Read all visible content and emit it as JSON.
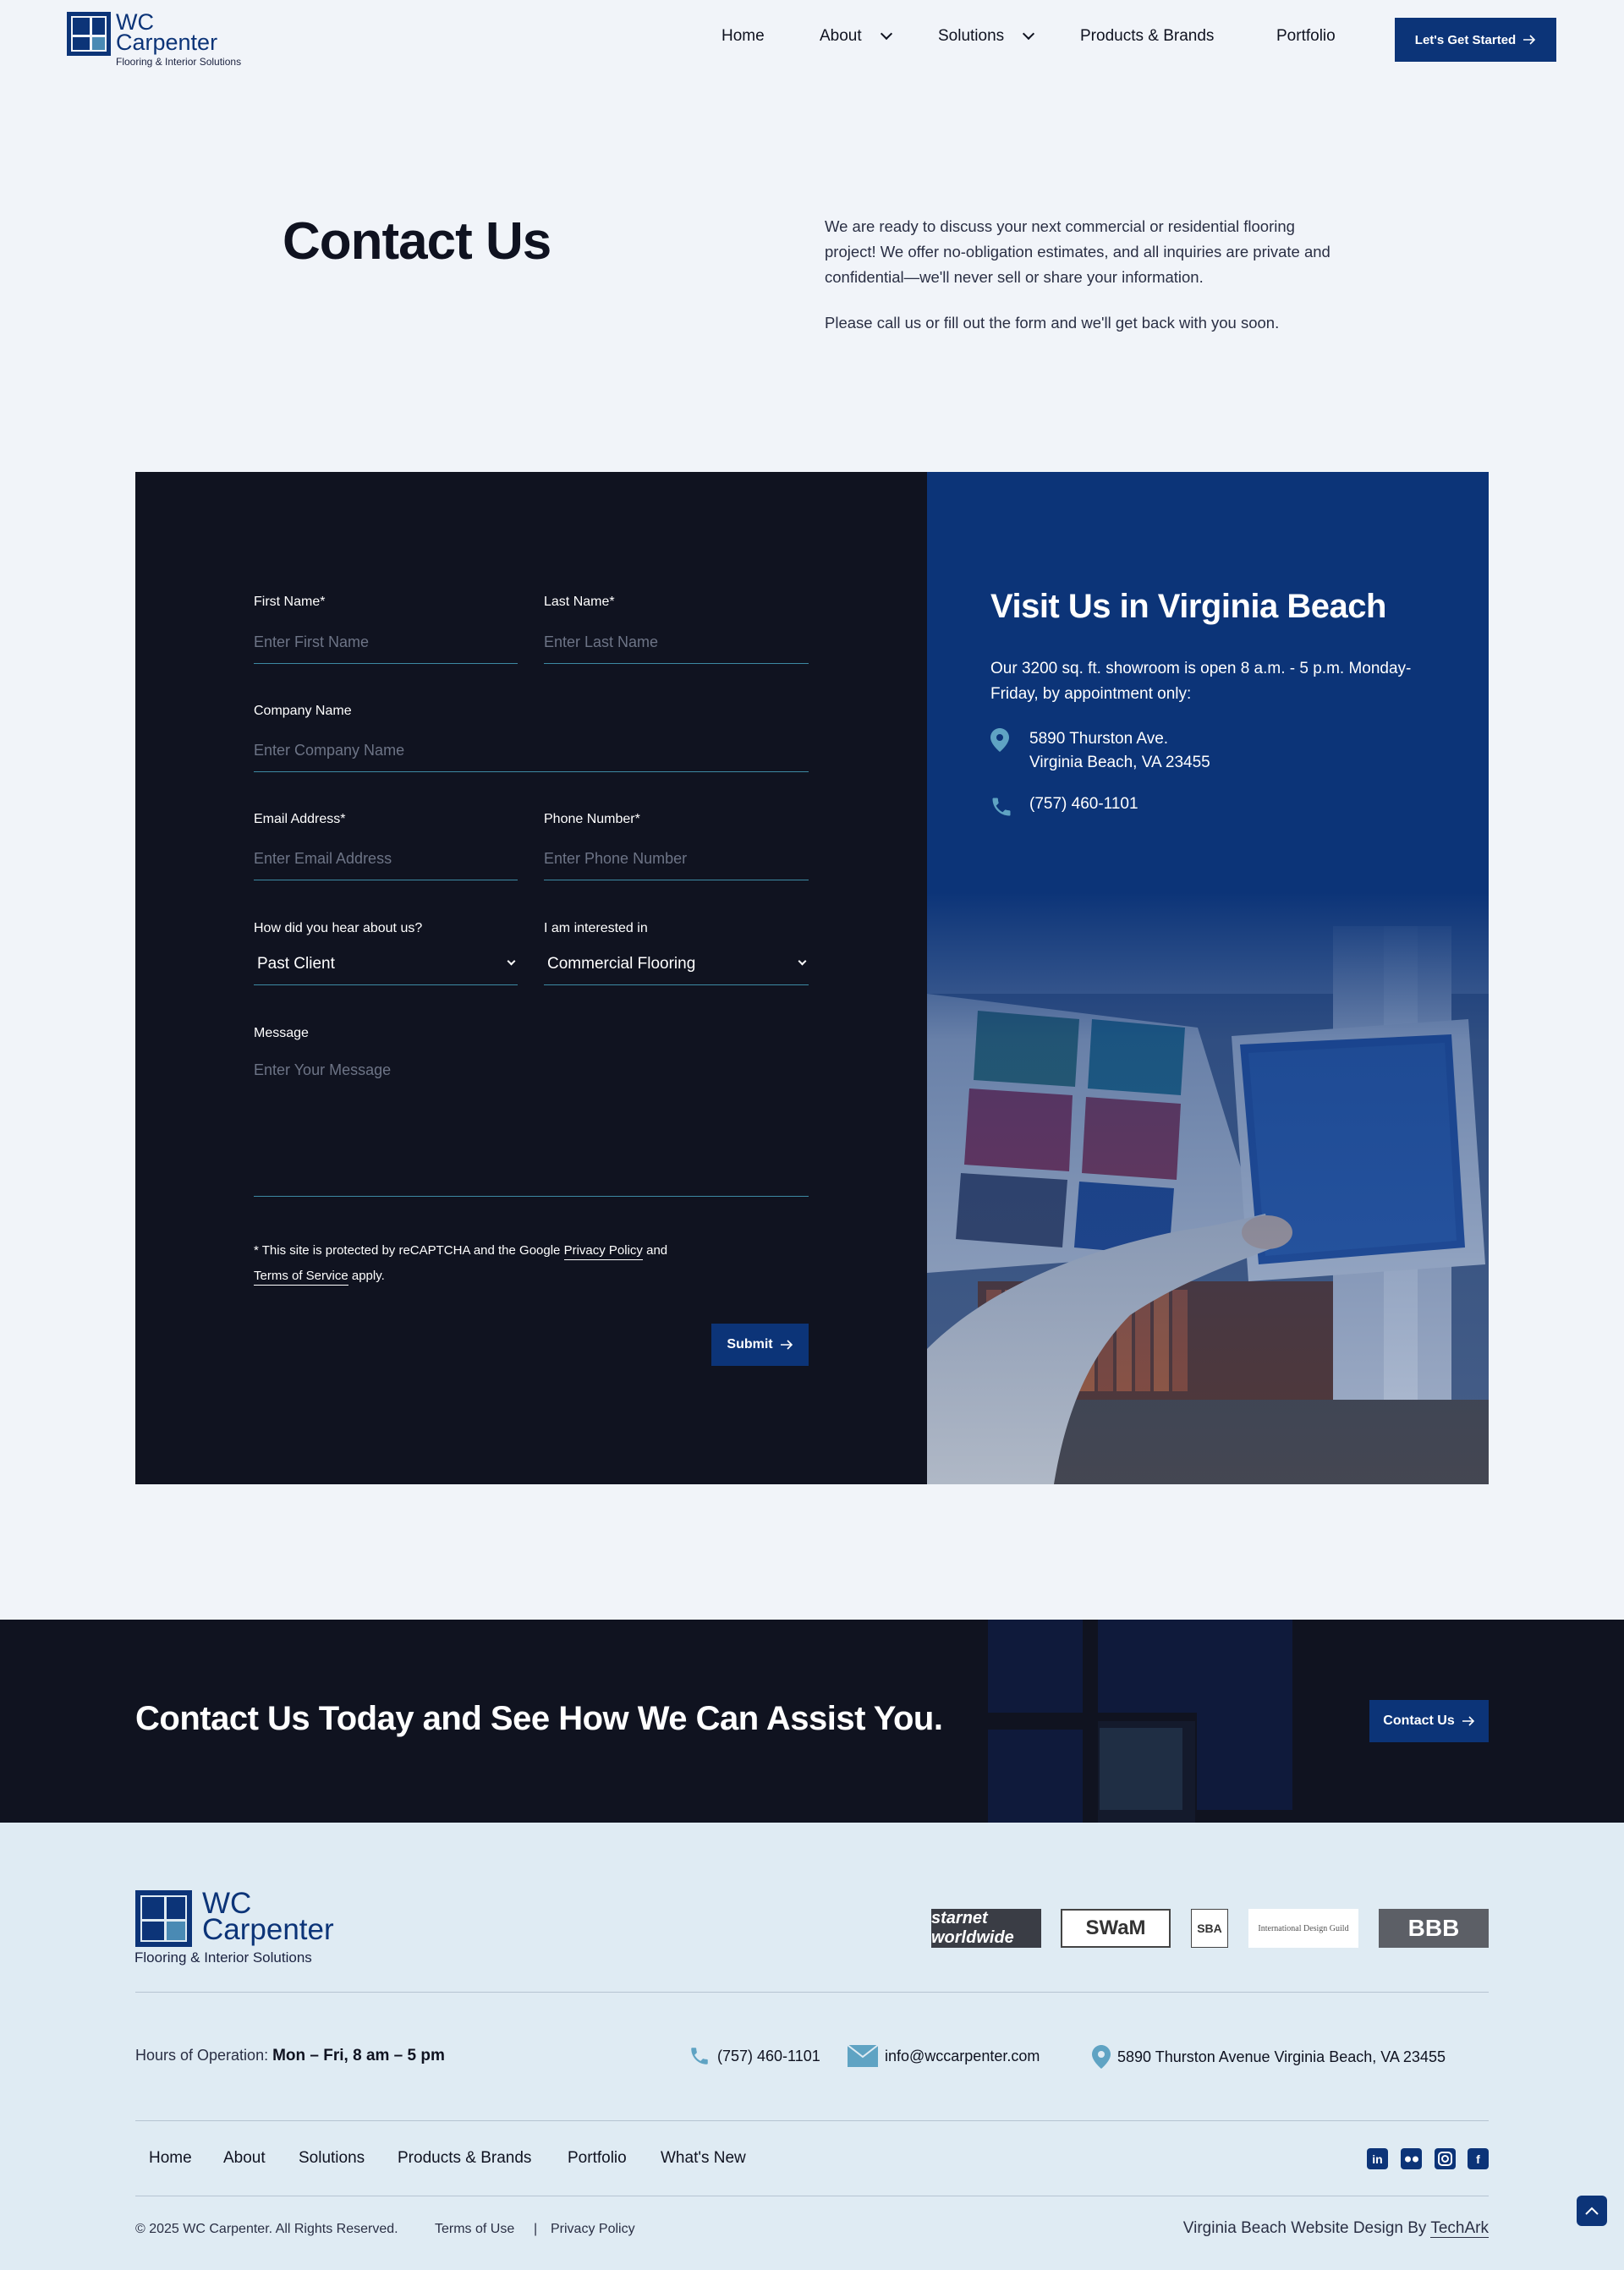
{
  "brand": {
    "name": "WC Carpenter",
    "name_line1": "WC",
    "name_line2": "Carpenter",
    "tagline": "Flooring & Interior Solutions",
    "color_primary": "#0c3478",
    "color_dark": "#101320"
  },
  "nav": {
    "items": [
      {
        "label": "Home"
      },
      {
        "label": "About"
      },
      {
        "label": "Solutions"
      },
      {
        "label": "Products & Brands"
      },
      {
        "label": "Portfolio"
      }
    ],
    "cta": "Let's Get Started"
  },
  "hero": {
    "title": "Contact Us",
    "para1": "We are ready to discuss your next commercial or residential flooring project! We offer no-obligation estimates, and all inquiries are private and confidential—we'll never sell or share your information.",
    "para2": "Please call us or fill out the form and we'll get back with you soon."
  },
  "form": {
    "first_name": {
      "label": "First Name*",
      "placeholder": "Enter First Name"
    },
    "last_name": {
      "label": "Last Name*",
      "placeholder": "Enter Last Name"
    },
    "company": {
      "label": "Company Name",
      "placeholder": "Enter Company Name"
    },
    "email": {
      "label": "Email Address*",
      "placeholder": "Enter Email Address"
    },
    "phone": {
      "label": "Phone Number*",
      "placeholder": "Enter Phone Number"
    },
    "heard": {
      "label": "How did you hear about us?",
      "value": "Past Client"
    },
    "interest": {
      "label": "I am interested in",
      "value": "Commercial Flooring"
    },
    "message": {
      "label": "Message",
      "placeholder": "Enter Your Message"
    },
    "recaptcha_prefix": "* This site is protected by reCAPTCHA and the Google",
    "privacy_link": "Privacy Policy",
    "recaptcha_and": "and",
    "terms_link": "Terms of Service",
    "recaptcha_suffix": "apply.",
    "submit": "Submit"
  },
  "visit": {
    "title": "Visit Us in Virginia Beach",
    "description": "Our 3200 sq. ft. showroom is open 8 a.m. - 5 p.m. Monday-Friday, by appointment only:",
    "address_line1": "5890 Thurston Ave.",
    "address_line2": "Virginia Beach, VA 23455",
    "phone": "(757) 460-1101"
  },
  "cta_band": {
    "title": "Contact Us Today and See How We Can Assist You.",
    "button": "Contact Us"
  },
  "footer": {
    "badges": [
      "starnet worldwide",
      "SWaM",
      "SBA",
      "International Design Guild",
      "BBB"
    ],
    "hours_label": "Hours of Operation:",
    "hours_value": "Mon – Fri, 8 am – 5 pm",
    "phone": "(757) 460-1101",
    "email": "info@wccarpenter.com",
    "address": "5890 Thurston Avenue Virginia Beach, VA 23455",
    "nav": [
      "Home",
      "About",
      "Solutions",
      "Products & Brands",
      "Portfolio",
      "What's New"
    ],
    "social": [
      "linkedin-icon",
      "flickr-icon",
      "instagram-icon",
      "facebook-icon"
    ],
    "copyright": "© 2025 WC Carpenter. All Rights Reserved.",
    "terms": "Terms of Use",
    "separator": "|",
    "privacy": "Privacy Policy",
    "credit_prefix": "Virginia Beach Website Design By",
    "credit_link": "TechArk"
  }
}
